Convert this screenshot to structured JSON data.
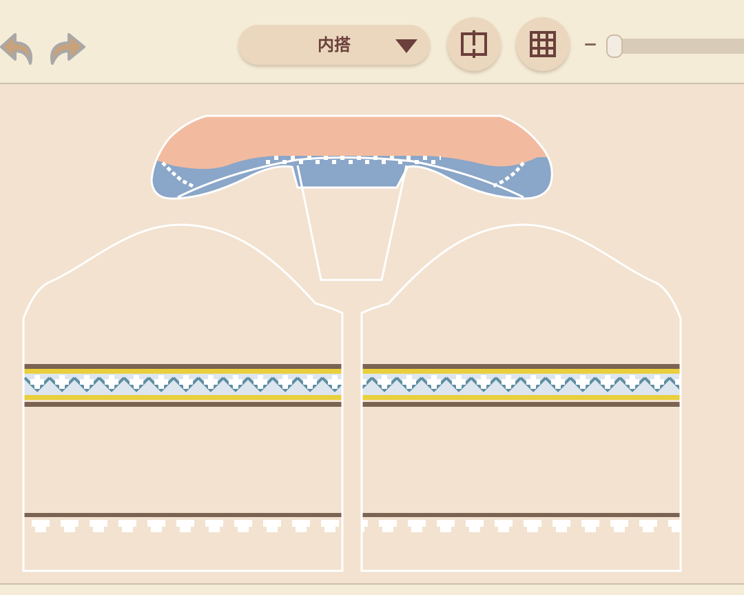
{
  "toolbar": {
    "undo_icon": "undo-arrow-icon",
    "redo_icon": "redo-arrow-icon",
    "layer_select": {
      "selected": "内搭"
    },
    "mirror_icon": "mirror-split-icon",
    "grid_icon": "grid-icon",
    "zoom": {
      "level": 0.02
    }
  },
  "colors": {
    "toolbar_bg": "#f5ecd7",
    "canvas_bg": "#f2e2cf",
    "accent_brown": "#6b3f3c",
    "collar_peach": "#f2bba0",
    "collar_blue": "#8aa6c8",
    "band_yellow": "#e9cf3c",
    "band_teal": "#5d8ea3",
    "band_brown": "#7a6351",
    "outline": "#ffffff"
  },
  "pattern": {
    "pieces": [
      "collar",
      "neck-placket",
      "left-front-panel",
      "right-front-panel"
    ],
    "panel_motifs": [
      "fair-isle-band",
      "hem-scallop-band"
    ]
  }
}
